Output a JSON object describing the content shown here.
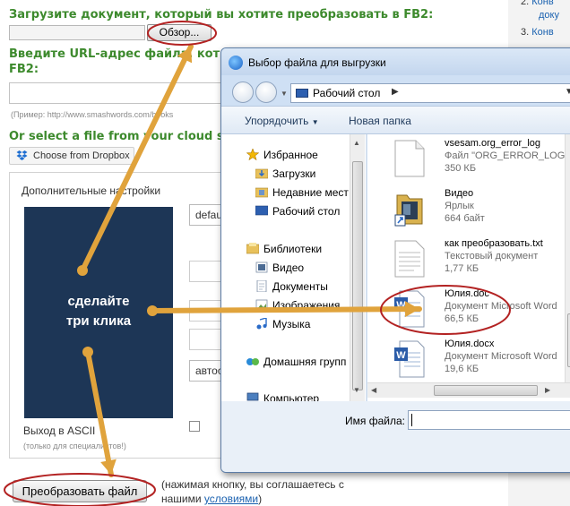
{
  "page": {
    "heading_upload": "Загрузите документ, который вы хотите преобразовать в FB2:",
    "browse_label": "Обзор...",
    "heading_url_1": "Введите URL-адрес файла, кот",
    "heading_url_2": "FB2:",
    "url_example": "(Пример: http://www.smashwords.com/books",
    "heading_cloud": "Or select a file from your cloud s",
    "dropbox_label": "Choose from Dropbox",
    "settings_title": "Дополнительные настройки",
    "select_default": "defau",
    "select_auto": "автоо",
    "ascii_label": "Выход в ASCII",
    "ascii_note": "(только для специалистов!)",
    "convert_label": "Преобразовать файл",
    "agree_line1": "(нажимая кнопку, вы соглашаетесь с",
    "agree_line2_prefix": "нашими ",
    "agree_link": "условиями",
    "agree_line2_suffix": ")"
  },
  "right_column": {
    "items": [
      {
        "num": "2.",
        "text": "Конв"
      },
      {
        "num": "",
        "text": "доку"
      },
      {
        "num": "3.",
        "text": "Конв"
      }
    ]
  },
  "annotation": {
    "text_line1": "сделайте",
    "text_line2": "три клика",
    "arrow_color": "#e0a33c",
    "circle_color": "#b32222"
  },
  "dialog": {
    "title": "Выбор файла для выгрузки",
    "address": "Рабочий стол",
    "organize_label": "Упорядочить",
    "new_folder_label": "Новая папка",
    "nav_items": [
      {
        "label": "Избранное",
        "icon": "star-icon"
      },
      {
        "label": "Загрузки",
        "icon": "downloads-folder-icon"
      },
      {
        "label": "Недавние мест",
        "icon": "recent-places-icon"
      },
      {
        "label": "Рабочий стол",
        "icon": "desktop-icon"
      },
      {
        "label": "Библиотеки",
        "icon": "libraries-icon"
      },
      {
        "label": "Видео",
        "icon": "video-library-icon"
      },
      {
        "label": "Документы",
        "icon": "documents-library-icon"
      },
      {
        "label": "Изображения",
        "icon": "pictures-library-icon"
      },
      {
        "label": "Музыка",
        "icon": "music-library-icon"
      },
      {
        "label": "Домашняя групп",
        "icon": "homegroup-icon"
      },
      {
        "label": "Компьютер",
        "icon": "computer-icon"
      }
    ],
    "files": [
      {
        "name": "vsesam.org_error_log",
        "type": "Файл \"ORG_ERROR_LOG\"",
        "size": "350 КБ",
        "icon": "generic-file-icon"
      },
      {
        "name": "Видео",
        "type": "Ярлык",
        "size": "664 байт",
        "icon": "shortcut-folder-icon"
      },
      {
        "name": "как преобразовать.txt",
        "type": "Текстовый документ",
        "size": "1,77 КБ",
        "icon": "text-file-icon"
      },
      {
        "name": "Юлия.doc",
        "type": "Документ Microsoft Word",
        "size": "66,5 КБ",
        "icon": "word-doc-icon"
      },
      {
        "name": "Юлия.docx",
        "type": "Документ Microsoft Word",
        "size": "19,6 КБ",
        "icon": "word-docx-icon"
      }
    ],
    "filename_label": "Имя файла:",
    "filename_value": ""
  }
}
